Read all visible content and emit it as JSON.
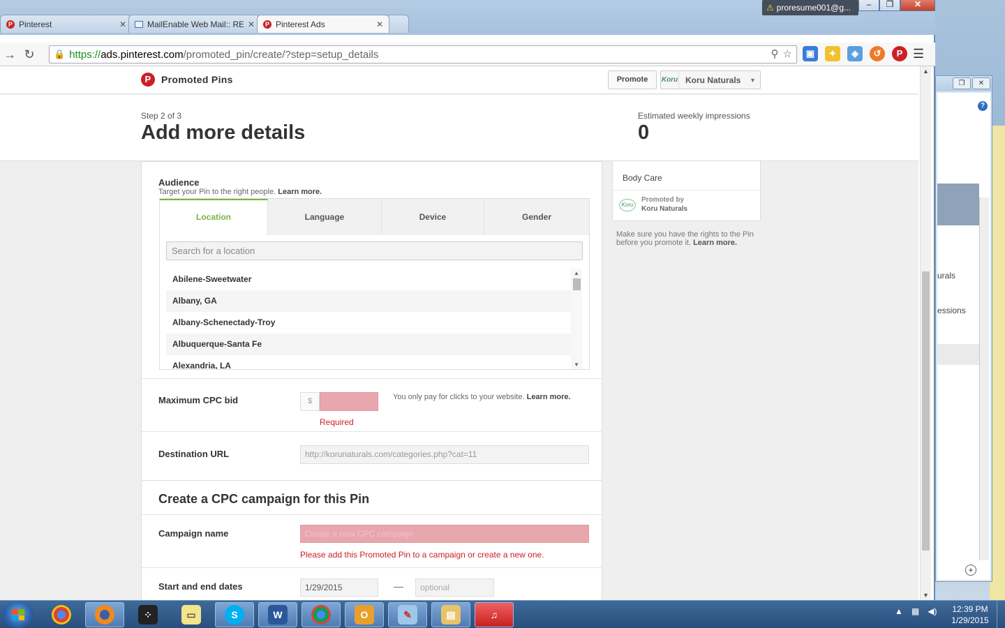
{
  "browser": {
    "tabs": [
      {
        "label": "Pinterest",
        "icon": "pinterest-icon",
        "active": false
      },
      {
        "label": "MailEnable Web Mail:: REI",
        "icon": "mail-icon",
        "active": false
      },
      {
        "label": "Pinterest Ads",
        "icon": "pinterest-icon",
        "active": true
      }
    ],
    "profile": "proresume001@g...",
    "url_scheme": "https://",
    "url_host": "ads.pinterest.com",
    "url_path": "/promoted_pin/create/?step=setup_details"
  },
  "header": {
    "brand": "Promoted Pins",
    "promote_label": "Promote",
    "account_name": "Koru Naturals"
  },
  "step": {
    "label": "Step 2 of 3",
    "title": "Add more details",
    "estimate_label": "Estimated weekly impressions",
    "estimate_value": "0"
  },
  "audience": {
    "title": "Audience",
    "subtitle": "Target your Pin to the right people.",
    "learn_more": "Learn more.",
    "tabs": [
      "Location",
      "Language",
      "Device",
      "Gender"
    ],
    "search_placeholder": "Search for a location",
    "locations": [
      "Abilene-Sweetwater",
      "Albany, GA",
      "Albany-Schenectady-Troy",
      "Albuquerque-Santa Fe",
      "Alexandria, LA"
    ]
  },
  "cpc": {
    "label": "Maximum CPC bid",
    "prefix": "$",
    "required": "Required",
    "help": "You only pay for clicks to your website.",
    "learn_more": "Learn more."
  },
  "destination": {
    "label": "Destination URL",
    "value": "http://korunaturals.com/categories.php?cat=11"
  },
  "campaign": {
    "title": "Create a CPC campaign for this Pin",
    "name_label": "Campaign name",
    "name_placeholder": "Create a new CPC campaign",
    "error": "Please add this Promoted Pin to a campaign or create a new one.",
    "dates_label": "Start and end dates",
    "start_date": "1/29/2015",
    "dash": "—",
    "end_placeholder": "optional"
  },
  "preview": {
    "category": "Body Care",
    "promoted_by": "Promoted by",
    "advertiser": "Koru Naturals",
    "rights_note": "Make sure you have the rights to the Pin before you promote it.",
    "learn_more": "Learn more."
  },
  "back_window": {
    "fragment_1": "urals",
    "fragment_2": "essions"
  },
  "taskbar": {
    "time": "12:39 PM",
    "date": "1/29/2015"
  }
}
